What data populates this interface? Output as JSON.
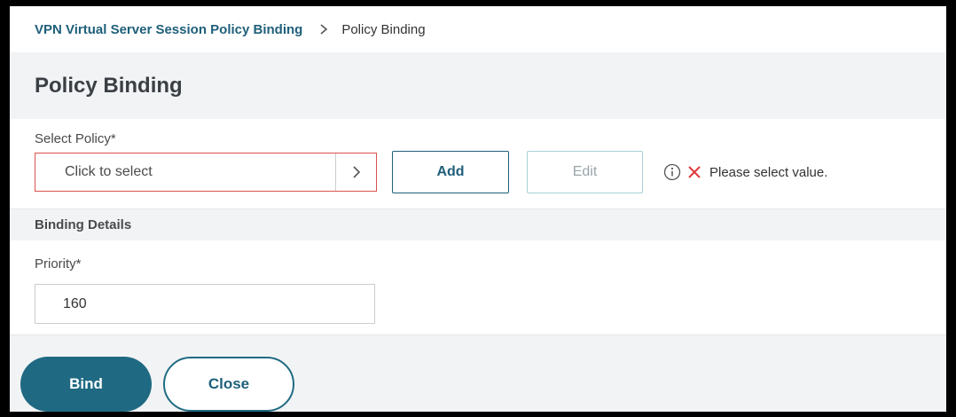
{
  "breadcrumb": {
    "parent": "VPN Virtual Server Session Policy Binding",
    "separator_icon": "chevron-right-icon",
    "current": "Policy Binding"
  },
  "page": {
    "title": "Policy Binding"
  },
  "policy": {
    "label": "Select Policy*",
    "placeholder": "Click to select",
    "chevron_icon": "chevron-right-icon",
    "add_label": "Add",
    "edit_label": "Edit",
    "info_icon": "info-icon",
    "error_icon": "error-x-icon",
    "validation_message": "Please select value."
  },
  "binding_details": {
    "heading": "Binding Details",
    "priority_label": "Priority*",
    "priority_value": "160"
  },
  "footer": {
    "bind_label": "Bind",
    "close_label": "Close"
  },
  "colors": {
    "accent": "#1f6a82",
    "link": "#1f5f7a",
    "error": "#e0393e",
    "error_border": "#d9534f",
    "panel_bg": "#f2f3f5"
  }
}
